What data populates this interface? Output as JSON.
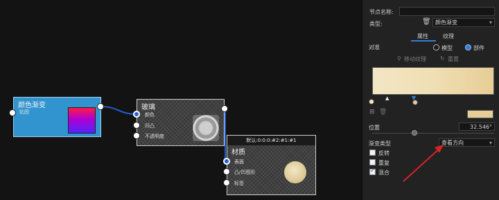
{
  "nodes": {
    "gradient": {
      "title": "颜色渐变",
      "output_label": "贴图"
    },
    "glass": {
      "title": "玻璃",
      "inputs": [
        "颜色",
        "凹凸",
        "不透明度"
      ]
    },
    "material": {
      "header": "默认:0:0:0:#2:#1:#1",
      "title": "材质",
      "inputs": [
        "表面",
        "凸/凹图形",
        "标签"
      ]
    }
  },
  "panel": {
    "node_name_label": "节点名称:",
    "node_name_value": "",
    "type_label": "类型:",
    "type_value": "颜色渐变",
    "tabs": [
      "属性",
      "纹理"
    ],
    "align_label": "对准",
    "align_options": [
      "模型",
      "部件"
    ],
    "align_selected": "部件",
    "move_texture": "移动纹理",
    "reset": "重置",
    "gradient_colors": [
      "#f3e6c3",
      "#efdfb4",
      "#e7cd96"
    ],
    "position_label": "位置",
    "position_value": "32.546°",
    "gradient_type_label": "渐变类型",
    "gradient_type_value": "查看方向",
    "checkboxes": [
      {
        "label": "反转",
        "checked": false
      },
      {
        "label": "重复",
        "checked": false
      },
      {
        "label": "混合",
        "checked": true
      }
    ]
  }
}
